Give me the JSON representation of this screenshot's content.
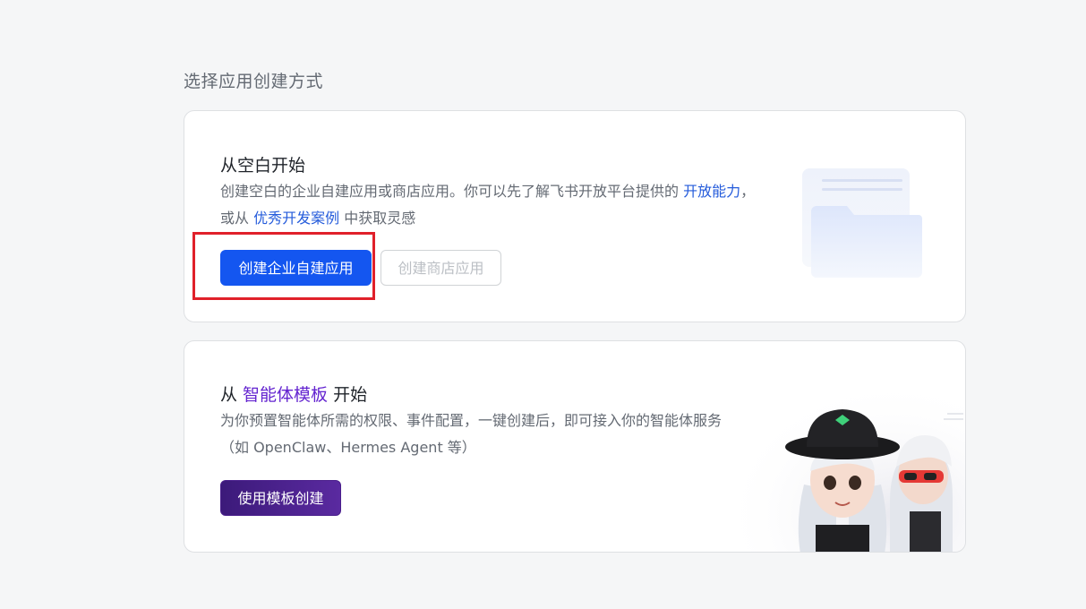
{
  "section_title": "选择应用创建方式",
  "blank_card": {
    "title": "从空白开始",
    "desc_before": "创建空白的企业自建应用或商店应用。你可以先了解飞书开放平台提供的 ",
    "link_capabilities": "开放能力",
    "desc_mid": "，或从 ",
    "link_cases": "优秀开发案例",
    "desc_after": " 中获取灵感",
    "primary_button": "创建企业自建应用",
    "store_button": "创建商店应用"
  },
  "agent_card": {
    "title_prefix": "从 ",
    "title_highlight": "智能体模板",
    "title_suffix": " 开始",
    "desc": "为你预置智能体所需的权限、事件配置，一键创建后，即可接入你的智能体服务（如 OpenClaw、Hermes Agent 等）",
    "button": "使用模板创建"
  },
  "colors": {
    "primary": "#1456f0",
    "link": "#245bdb",
    "agent_purple": "#6425d0",
    "highlight": "#e0202a"
  }
}
